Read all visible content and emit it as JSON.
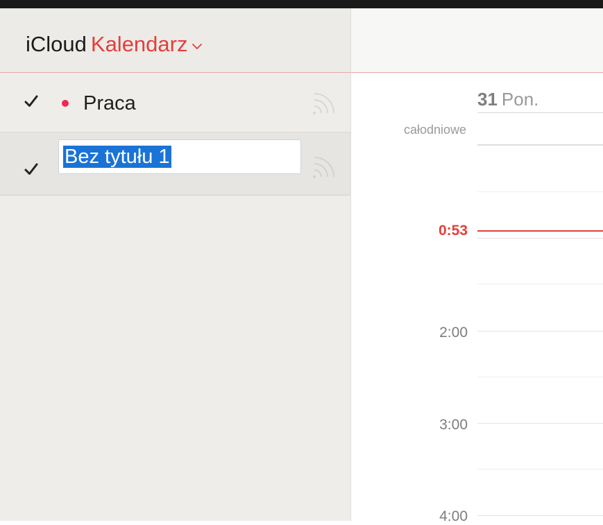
{
  "app": {
    "brand": "iCloud",
    "name": "Kalendarz"
  },
  "calendars": [
    {
      "label": "Praca",
      "checked": true,
      "color": "#f0294e"
    },
    {
      "label": "Bez tytułu 1",
      "checked": true,
      "editing": true
    }
  ],
  "day_view": {
    "day_number": "31",
    "day_name": "Pon.",
    "all_day_label": "całodniowe",
    "current_time": "0:53",
    "hours": [
      "2:00",
      "3:00",
      "4:00"
    ]
  },
  "colors": {
    "accent": "#e43e3a",
    "selection": "#1a73d6",
    "sidebar_bg": "#eeedea"
  }
}
